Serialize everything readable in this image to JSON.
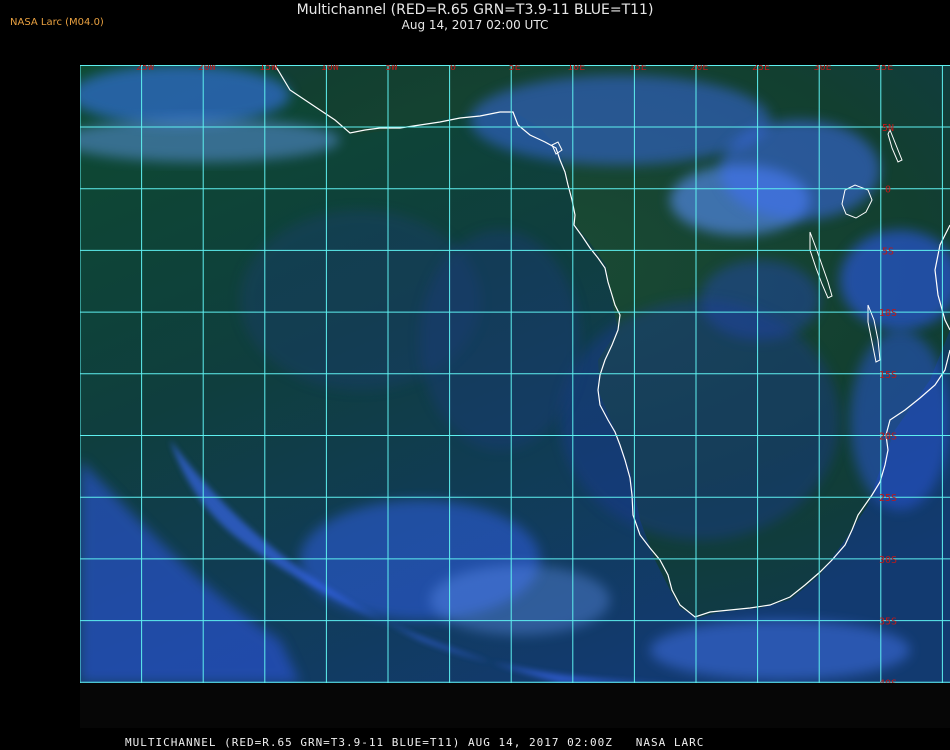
{
  "header": {
    "credit": "NASA Larc (M04.0)",
    "title": "Multichannel (RED=R.65 GRN=T3.9-11 BLUE=T11)",
    "timestamp": "Aug 14, 2017 02:00 UTC"
  },
  "map": {
    "longitude_labels": [
      "25W",
      "20W",
      "15W",
      "10W",
      "5W",
      "0",
      "5E",
      "10E",
      "15E",
      "20E",
      "25E",
      "30E",
      "35E"
    ],
    "latitude_labels": [
      "5N",
      "0",
      "5S",
      "10S",
      "15S",
      "20S",
      "25S",
      "30S",
      "35S",
      "40S"
    ],
    "colors": {
      "grid": "#5ef0f0",
      "label": "#c01818",
      "coastline": "#ffffff",
      "land": "#15402a",
      "ocean": "#0c3a5a",
      "cloud": "#3a7cff"
    }
  },
  "footer": {
    "text": "MULTICHANNEL (RED=R.65 GRN=T3.9-11 BLUE=T11) AUG 14, 2017 02:00Z   NASA LARC"
  }
}
